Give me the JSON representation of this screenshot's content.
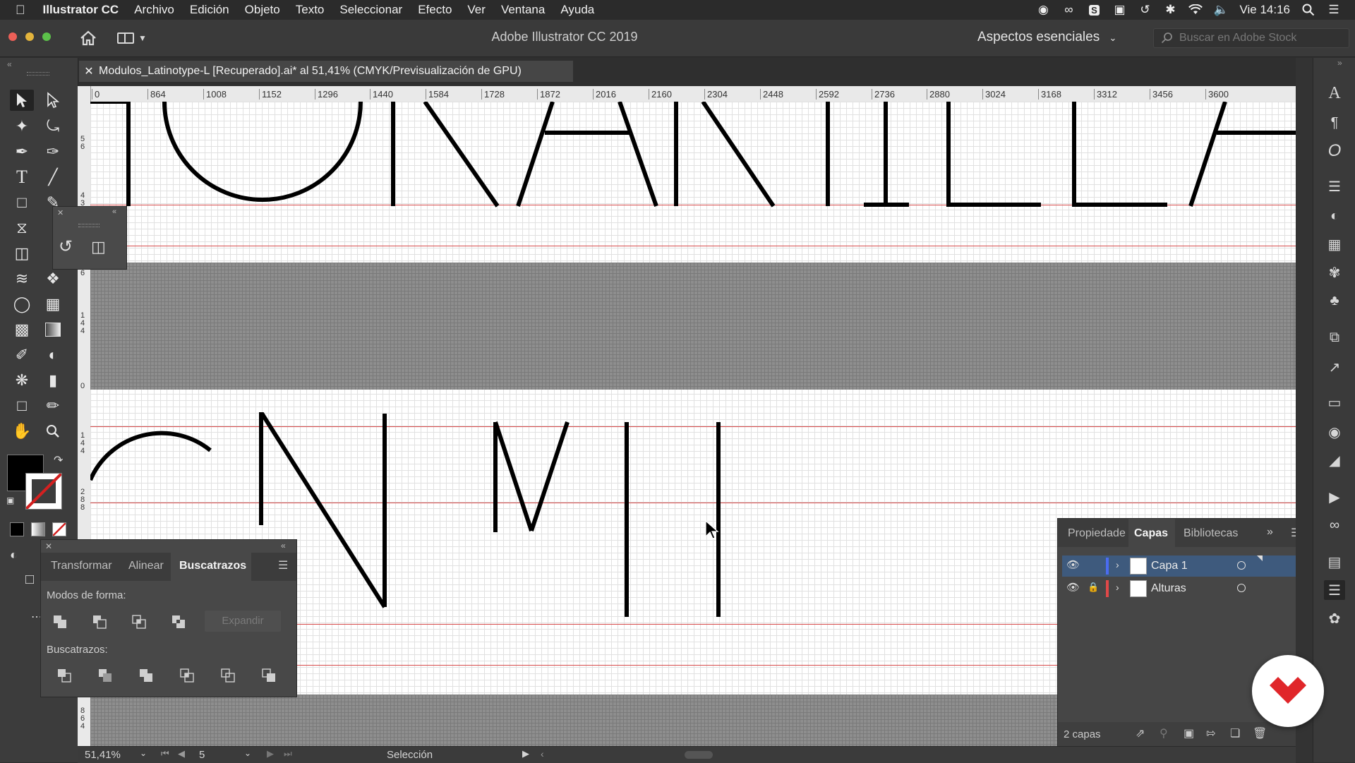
{
  "menubar": {
    "app_name": "Illustrator CC",
    "items": [
      "Archivo",
      "Edición",
      "Objeto",
      "Texto",
      "Seleccionar",
      "Efecto",
      "Ver",
      "Ventana",
      "Ayuda"
    ],
    "clock": "Vie 14:16"
  },
  "app": {
    "title": "Adobe Illustrator CC 2019",
    "workspace": "Aspectos esenciales",
    "stock_placeholder": "Buscar en Adobe Stock"
  },
  "document": {
    "tab_title": "Modulos_Latinotype-L [Recuperado].ai* al 51,41% (CMYK/Previsualización de GPU)"
  },
  "ruler": {
    "top_ticks": [
      "0",
      "864",
      "1008",
      "1152",
      "1296",
      "1440",
      "1584",
      "1728",
      "1872",
      "2016",
      "2160",
      "2304",
      "2448",
      "2592",
      "2736",
      "2880",
      "3024",
      "3168",
      "3312",
      "3456",
      "3600"
    ],
    "left_ticks": [
      "5 6",
      "4 3",
      "6",
      "1 4 4",
      "0",
      "1 4 4",
      "2 8 8",
      "8 6 4"
    ]
  },
  "canvas": {
    "top_letters": [
      "H",
      "O",
      "R",
      "A",
      "R",
      "T",
      "I",
      "L",
      "L",
      "A"
    ],
    "bottom_letters": [
      "G",
      "N",
      "M",
      "I"
    ]
  },
  "pathfinder": {
    "tabs": [
      "Transformar",
      "Alinear",
      "Buscatrazos"
    ],
    "active_tab": "Buscatrazos",
    "shape_modes_label": "Modos de forma:",
    "expand_label": "Expandir",
    "pathfinders_label": "Buscatrazos:"
  },
  "layers": {
    "tabs": [
      "Propiedade",
      "Capas",
      "Bibliotecas"
    ],
    "active_tab": "Capas",
    "rows": [
      {
        "name": "Capa 1",
        "color": "#4a6cf0",
        "selected": true,
        "locked": false
      },
      {
        "name": "Alturas",
        "color": "#e04848",
        "selected": false,
        "locked": true
      }
    ],
    "count_label": "2 capas"
  },
  "status": {
    "zoom": "51,41%",
    "artboard": "5",
    "tool": "Selección"
  },
  "colors": {
    "accent_selected_row": "#3e5a7d",
    "guide_red": "#d74a4a",
    "badge_red": "#e0262a"
  }
}
